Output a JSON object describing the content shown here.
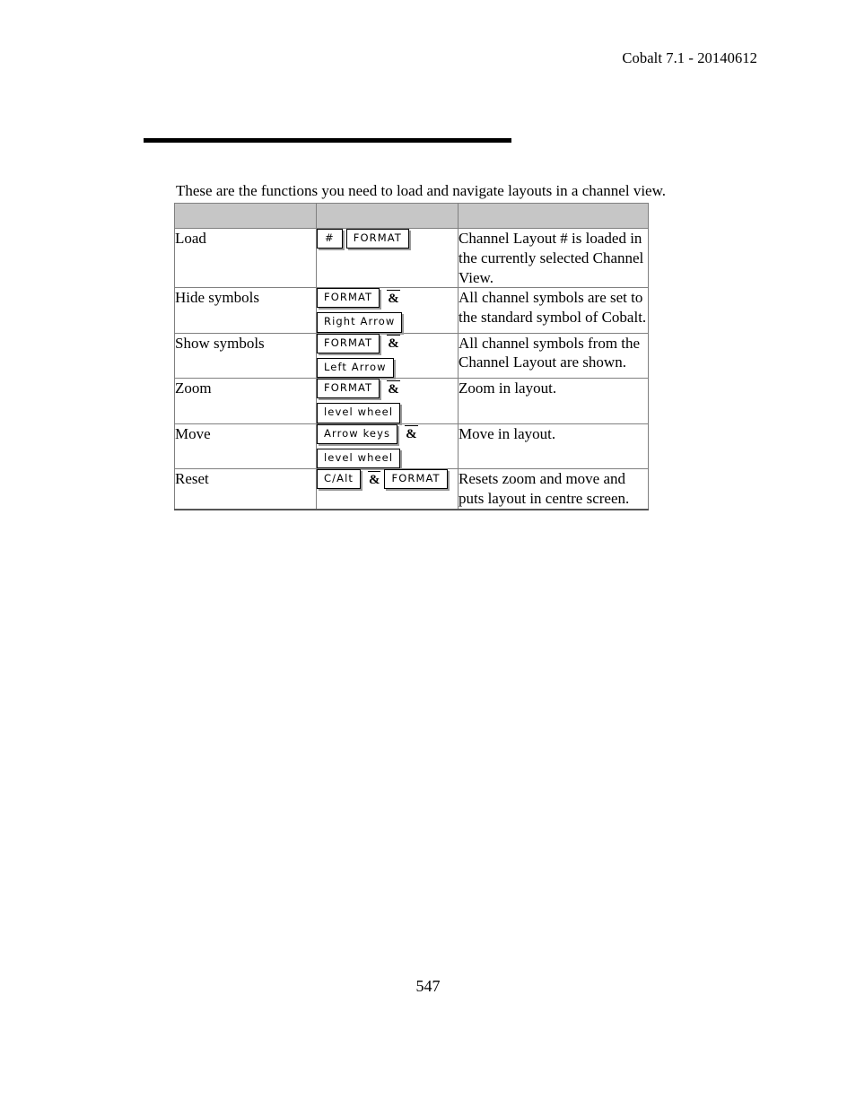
{
  "document": {
    "running_header": "Cobalt 7.1 - 20140612",
    "page_number": "547",
    "intro": "These are the functions you need to load and navigate layouts in a channel view."
  },
  "table": {
    "header": {
      "col_action": "",
      "col_keys": "",
      "col_desc": ""
    },
    "rows": [
      {
        "action": "Load",
        "keys": [
          {
            "type": "key",
            "label": "#",
            "narrow": true
          },
          {
            "type": "key",
            "label": "FORMAT"
          }
        ],
        "keys_lines": [
          [
            {
              "kind": "key",
              "label": "#"
            },
            {
              "kind": "key",
              "label": "FORMAT"
            }
          ]
        ],
        "description": "Channel Layout # is loaded in the currently selected Channel View."
      },
      {
        "action": "Hide symbols",
        "keys_lines": [
          [
            {
              "kind": "key",
              "label": "FORMAT"
            },
            {
              "kind": "amp",
              "label": "&"
            }
          ],
          [
            {
              "kind": "key",
              "label": "Right Arrow"
            }
          ]
        ],
        "description": "All channel symbols are set to the standard symbol of Cobalt."
      },
      {
        "action": "Show symbols",
        "keys_lines": [
          [
            {
              "kind": "key",
              "label": "FORMAT"
            },
            {
              "kind": "amp",
              "label": "&"
            }
          ],
          [
            {
              "kind": "key",
              "label": "Left Arrow"
            }
          ]
        ],
        "description": "All channel symbols from the Channel Layout are shown."
      },
      {
        "action": "Zoom",
        "keys_lines": [
          [
            {
              "kind": "key",
              "label": "FORMAT"
            },
            {
              "kind": "amp",
              "label": "&"
            }
          ],
          [
            {
              "kind": "key",
              "label": "level wheel"
            }
          ]
        ],
        "description": "Zoom in layout."
      },
      {
        "action": "Move",
        "keys_lines": [
          [
            {
              "kind": "key",
              "label": "Arrow keys"
            },
            {
              "kind": "amp",
              "label": "&"
            }
          ],
          [
            {
              "kind": "key",
              "label": "level wheel"
            }
          ]
        ],
        "description": "Move in layout."
      },
      {
        "action": "Reset",
        "keys_lines": [
          [
            {
              "kind": "key",
              "label": "C/Alt"
            },
            {
              "kind": "amp",
              "label": "&"
            },
            {
              "kind": "key",
              "label": "FORMAT"
            }
          ]
        ],
        "description": "Resets zoom and move and puts layout in centre screen."
      }
    ]
  },
  "colors": {
    "header_row_fill": "#c6c6c6",
    "table_border": "#808080",
    "rule": "#000000",
    "key_shadow": "#9a9a9a"
  }
}
